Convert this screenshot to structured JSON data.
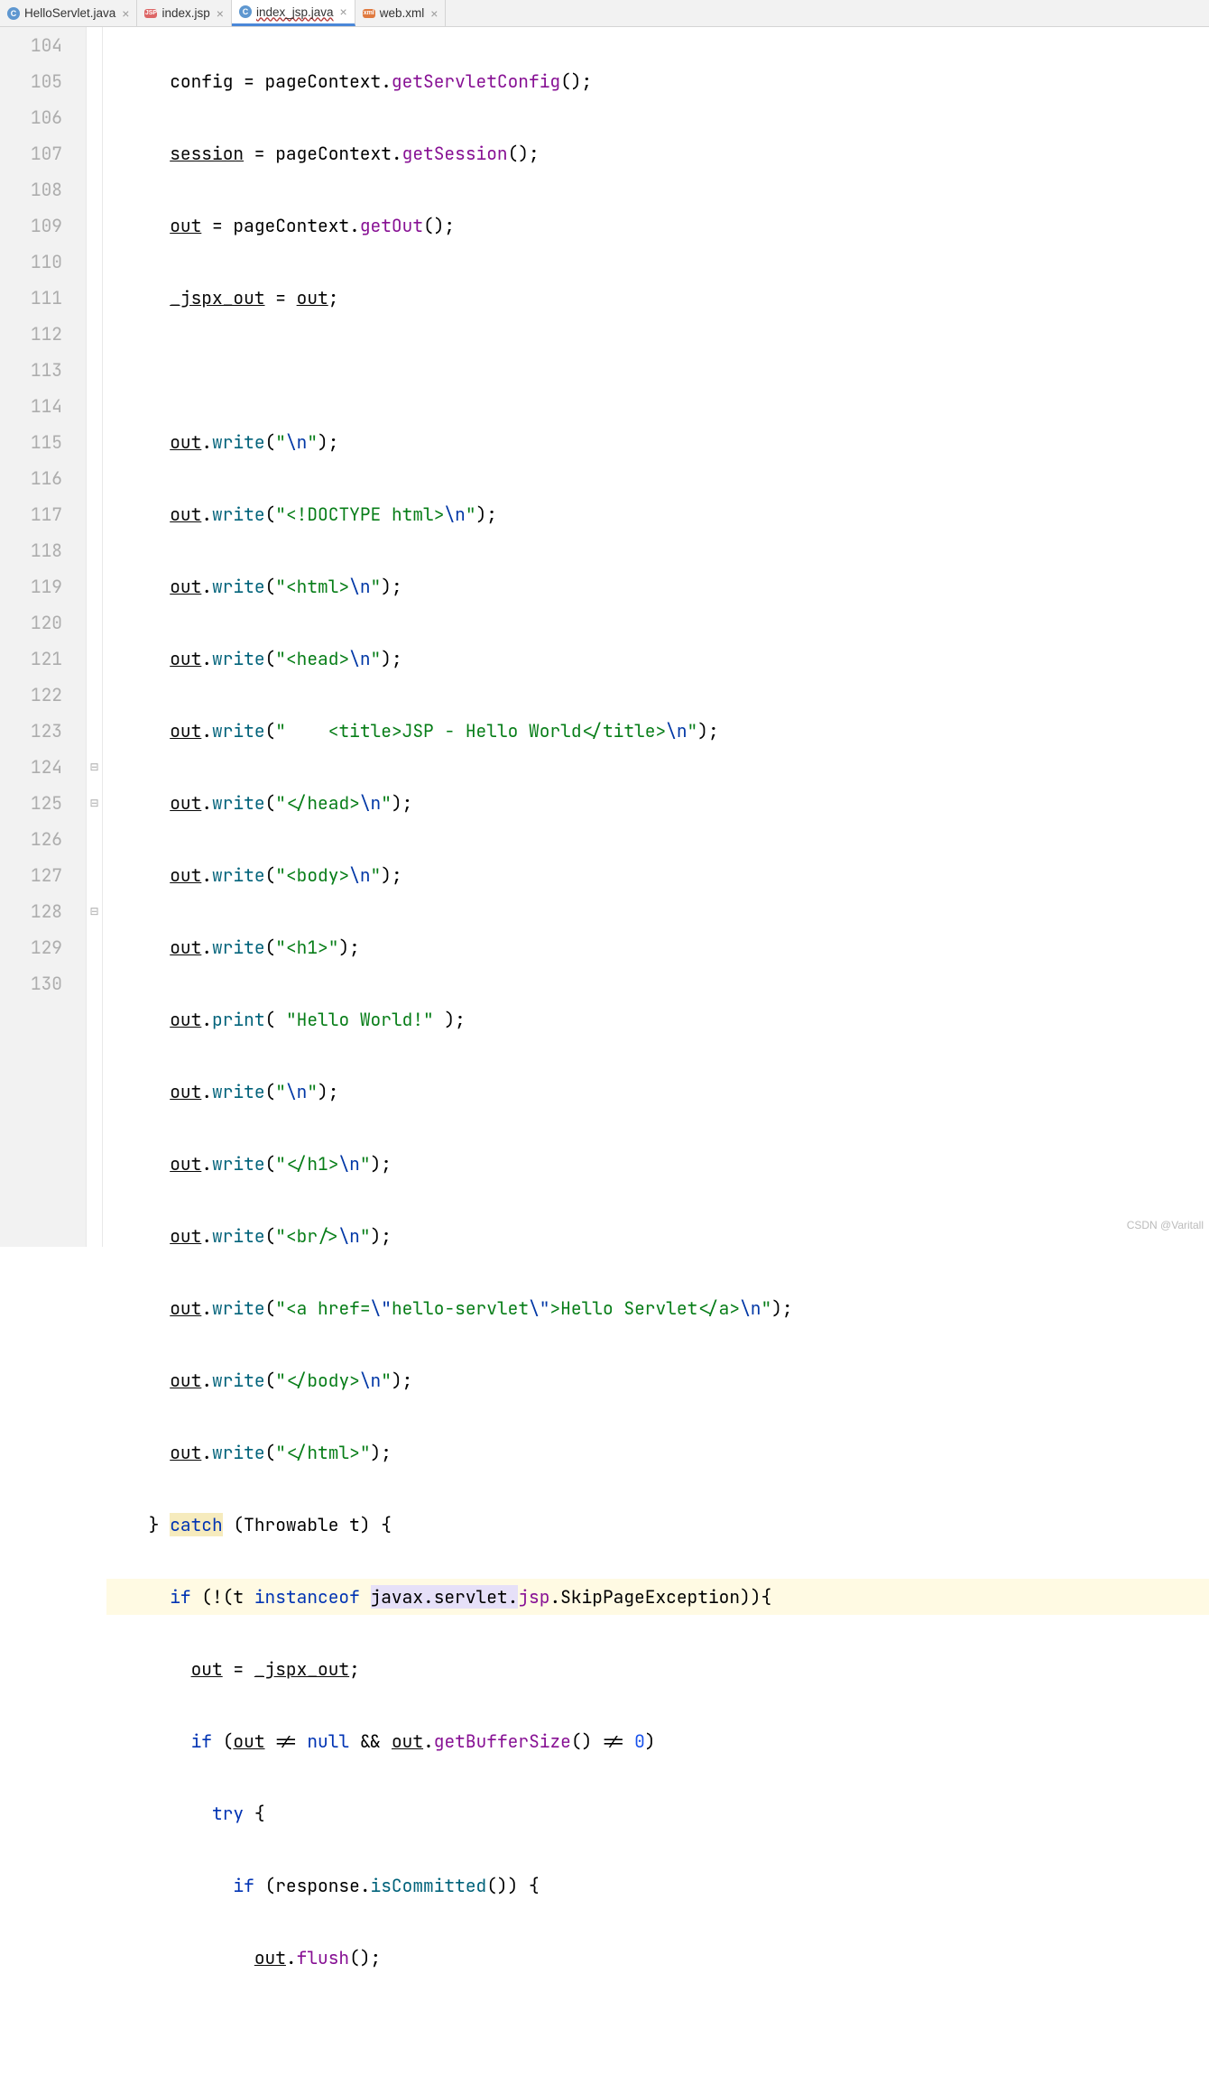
{
  "tabs": [
    {
      "label": "HelloServlet.java",
      "icon": "c-icon",
      "active": false
    },
    {
      "label": "index.jsp",
      "icon": "jsp-icon",
      "active": false
    },
    {
      "label": "index_jsp.java",
      "icon": "c-icon",
      "active": true,
      "squiggle": true
    },
    {
      "label": "web.xml",
      "icon": "xml-icon",
      "active": false
    }
  ],
  "lines": {
    "start": 104,
    "end": 130
  },
  "code": {
    "l104": {
      "v": "config",
      "m": "getServletConfig"
    },
    "l105": {
      "v": "session",
      "m": "getSession"
    },
    "l106": {
      "v": "out",
      "m": "getOut"
    },
    "l107": {
      "a": "_jspx_out",
      "b": "out"
    },
    "l109_str": "\\n",
    "l110_str1": "<!DOCTYPE html>",
    "l110_str2": "\\n",
    "l111_str1": "<html>",
    "l111_str2": "\\n",
    "l112_str1": "<head>",
    "l112_str2": "\\n",
    "l113_str1": "    <title>JSP - Hello World</title>",
    "l113_str2": "\\n",
    "l114_str1": "</head>",
    "l114_str2": "\\n",
    "l115_str1": "<body>",
    "l115_str2": "\\n",
    "l116_str": "<h1>",
    "l117_str": "Hello World!",
    "l118_str": "\\n",
    "l119_str1": "</h1>",
    "l119_str2": "\\n",
    "l120_str1": "<br/>",
    "l120_str2": "\\n",
    "l121_str1": "<a href=",
    "l121_esc1": "\\\"",
    "l121_str2": "hello-servlet",
    "l121_esc2": "\\\"",
    "l121_str3": ">Hello Servlet</a>",
    "l121_str4": "\\n",
    "l122_str1": "</body>",
    "l122_str2": "\\n",
    "l123_str": "</html>",
    "l124_kw": "catch",
    "l124_t": "Throwable t",
    "l125_kw1": "if",
    "l125_kw2": "instanceof",
    "l125_pkg": "javax.servlet.",
    "l125_jsp": "jsp",
    "l125_ex": ".SkipPageException",
    "l126_a": "out",
    "l126_b": "_jspx_out",
    "l127_kw": "if",
    "l127_out": "out",
    "l127_null": "null",
    "l127_m": "getBufferSize",
    "l127_zero": "0",
    "l128_kw": "try",
    "l129_kw": "if",
    "l129_r": "response",
    "l129_m": "isCommitted",
    "l130_out": "out",
    "l130_m": "flush"
  },
  "watermark": "CSDN @Varitall"
}
